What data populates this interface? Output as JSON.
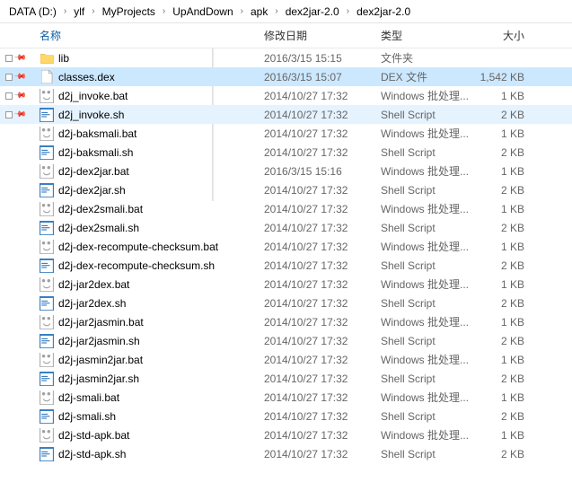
{
  "breadcrumb": [
    "DATA (D:)",
    "ylf",
    "MyProjects",
    "UpAndDown",
    "apk",
    "dex2jar-2.0",
    "dex2jar-2.0"
  ],
  "columns": {
    "name": "名称",
    "date": "修改日期",
    "type": "类型",
    "size": "大小"
  },
  "files": [
    {
      "name": "lib",
      "date": "2016/3/15 15:15",
      "type": "文件夹",
      "size": "",
      "icon": "folder",
      "pin": true,
      "state": ""
    },
    {
      "name": "classes.dex",
      "date": "2016/3/15 15:07",
      "type": "DEX 文件",
      "size": "1,542 KB",
      "icon": "file",
      "pin": true,
      "state": "selected"
    },
    {
      "name": "d2j_invoke.bat",
      "date": "2014/10/27 17:32",
      "type": "Windows 批处理...",
      "size": "1 KB",
      "icon": "bat",
      "pin": true,
      "state": ""
    },
    {
      "name": "d2j_invoke.sh",
      "date": "2014/10/27 17:32",
      "type": "Shell Script",
      "size": "2 KB",
      "icon": "sh",
      "pin": true,
      "state": "highlighted"
    },
    {
      "name": "d2j-baksmali.bat",
      "date": "2014/10/27 17:32",
      "type": "Windows 批处理...",
      "size": "1 KB",
      "icon": "bat",
      "pin": false,
      "state": ""
    },
    {
      "name": "d2j-baksmali.sh",
      "date": "2014/10/27 17:32",
      "type": "Shell Script",
      "size": "2 KB",
      "icon": "sh",
      "pin": false,
      "state": ""
    },
    {
      "name": "d2j-dex2jar.bat",
      "date": "2016/3/15 15:16",
      "type": "Windows 批处理...",
      "size": "1 KB",
      "icon": "bat",
      "pin": false,
      "state": ""
    },
    {
      "name": "d2j-dex2jar.sh",
      "date": "2014/10/27 17:32",
      "type": "Shell Script",
      "size": "2 KB",
      "icon": "sh",
      "pin": false,
      "state": ""
    },
    {
      "name": "d2j-dex2smali.bat",
      "date": "2014/10/27 17:32",
      "type": "Windows 批处理...",
      "size": "1 KB",
      "icon": "bat",
      "pin": false,
      "state": ""
    },
    {
      "name": "d2j-dex2smali.sh",
      "date": "2014/10/27 17:32",
      "type": "Shell Script",
      "size": "2 KB",
      "icon": "sh",
      "pin": false,
      "state": ""
    },
    {
      "name": "d2j-dex-recompute-checksum.bat",
      "date": "2014/10/27 17:32",
      "type": "Windows 批处理...",
      "size": "1 KB",
      "icon": "bat",
      "pin": false,
      "state": ""
    },
    {
      "name": "d2j-dex-recompute-checksum.sh",
      "date": "2014/10/27 17:32",
      "type": "Shell Script",
      "size": "2 KB",
      "icon": "sh",
      "pin": false,
      "state": ""
    },
    {
      "name": "d2j-jar2dex.bat",
      "date": "2014/10/27 17:32",
      "type": "Windows 批处理...",
      "size": "1 KB",
      "icon": "bat",
      "pin": false,
      "state": ""
    },
    {
      "name": "d2j-jar2dex.sh",
      "date": "2014/10/27 17:32",
      "type": "Shell Script",
      "size": "2 KB",
      "icon": "sh",
      "pin": false,
      "state": ""
    },
    {
      "name": "d2j-jar2jasmin.bat",
      "date": "2014/10/27 17:32",
      "type": "Windows 批处理...",
      "size": "1 KB",
      "icon": "bat",
      "pin": false,
      "state": ""
    },
    {
      "name": "d2j-jar2jasmin.sh",
      "date": "2014/10/27 17:32",
      "type": "Shell Script",
      "size": "2 KB",
      "icon": "sh",
      "pin": false,
      "state": ""
    },
    {
      "name": "d2j-jasmin2jar.bat",
      "date": "2014/10/27 17:32",
      "type": "Windows 批处理...",
      "size": "1 KB",
      "icon": "bat",
      "pin": false,
      "state": ""
    },
    {
      "name": "d2j-jasmin2jar.sh",
      "date": "2014/10/27 17:32",
      "type": "Shell Script",
      "size": "2 KB",
      "icon": "sh",
      "pin": false,
      "state": ""
    },
    {
      "name": "d2j-smali.bat",
      "date": "2014/10/27 17:32",
      "type": "Windows 批处理...",
      "size": "1 KB",
      "icon": "bat",
      "pin": false,
      "state": ""
    },
    {
      "name": "d2j-smali.sh",
      "date": "2014/10/27 17:32",
      "type": "Shell Script",
      "size": "2 KB",
      "icon": "sh",
      "pin": false,
      "state": ""
    },
    {
      "name": "d2j-std-apk.bat",
      "date": "2014/10/27 17:32",
      "type": "Windows 批处理...",
      "size": "1 KB",
      "icon": "bat",
      "pin": false,
      "state": ""
    },
    {
      "name": "d2j-std-apk.sh",
      "date": "2014/10/27 17:32",
      "type": "Shell Script",
      "size": "2 KB",
      "icon": "sh",
      "pin": false,
      "state": ""
    }
  ]
}
